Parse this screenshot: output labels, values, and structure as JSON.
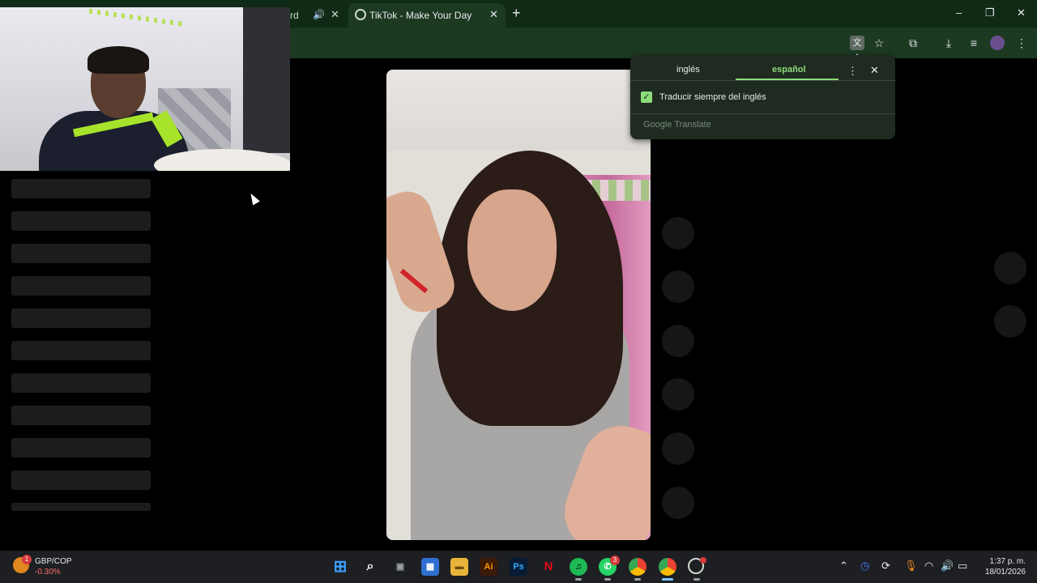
{
  "browser": {
    "prev_tab_title_fragment": "rd",
    "prev_tab_icons": [
      "speaker-icon",
      "close-icon"
    ],
    "active_tab_title": "TikTok - Make Your Day",
    "new_tab_label": "+",
    "window_controls": {
      "minimize": "–",
      "restore": "❐",
      "close": "✕"
    }
  },
  "toolbar_icons": [
    "translate-icon",
    "star-icon",
    "extensions-icon",
    "download-icon",
    "reading-list-icon",
    "profile-avatar-icon",
    "more-menu-icon"
  ],
  "translate_popup": {
    "source_language": "inglés",
    "target_language": "español",
    "always_translate_label": "Traducir siempre del inglés",
    "always_translate_checked": true,
    "brand": "Google Translate"
  },
  "taskbar": {
    "widget": {
      "pair": "GBP/COP",
      "change": "-0.30%",
      "badge": "1"
    },
    "apps": [
      {
        "name": "windows-start",
        "glyph": "⊞",
        "color": "#3aa0ff"
      },
      {
        "name": "search",
        "glyph": "⌕",
        "color": "#1d1f22"
      },
      {
        "name": "task-view",
        "glyph": "▣",
        "color": "#1d1f22"
      },
      {
        "name": "store",
        "glyph": "🛍",
        "color": "#2f6fd1"
      },
      {
        "name": "file-explorer",
        "glyph": "▬",
        "color": "#e8b53a"
      },
      {
        "name": "illustrator",
        "glyph": "Ai",
        "color": "#3b1a06"
      },
      {
        "name": "photoshop",
        "glyph": "Ps",
        "color": "#071b35"
      },
      {
        "name": "netflix",
        "glyph": "N",
        "color": "#1d1f22"
      },
      {
        "name": "spotify",
        "glyph": "♫",
        "color": "#1db954"
      },
      {
        "name": "whatsapp",
        "glyph": "✆",
        "color": "#25d366",
        "badge": "3"
      },
      {
        "name": "chrome",
        "glyph": "◉",
        "color": "#ea4335"
      },
      {
        "name": "chrome-active",
        "glyph": "◉",
        "color": "#ea4335"
      },
      {
        "name": "obs",
        "glyph": "◌",
        "color": "#1d1f22"
      }
    ],
    "tray_icons": [
      "chevron-up-icon",
      "clock-app-icon",
      "sync-icon",
      "microphone-icon",
      "wifi-icon",
      "volume-icon",
      "battery-icon"
    ],
    "time": "1:37 p. m.",
    "date": "18/01/2026"
  },
  "colors": {
    "accent": "#8ddc79",
    "tab_strip": "#0f2a15",
    "toolbar": "#1c3a22"
  }
}
